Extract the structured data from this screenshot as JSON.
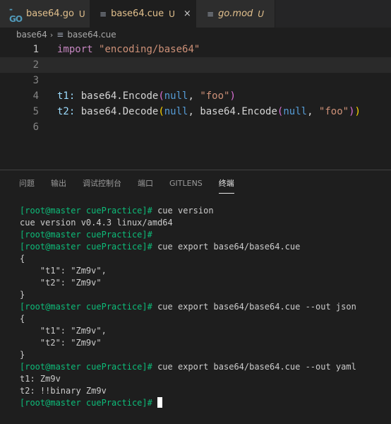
{
  "tabs": [
    {
      "label": "base64.go",
      "modified": "U",
      "icon": "go-file-icon",
      "active": false
    },
    {
      "label": "base64.cue",
      "modified": "U",
      "icon": "lines-file-icon",
      "active": true
    },
    {
      "label": "go.mod",
      "modified": "U",
      "icon": "lines-file-icon",
      "active": false
    }
  ],
  "tab_close": "×",
  "breadcrumb": {
    "folder": "base64",
    "separator": "›",
    "file": "base64.cue"
  },
  "editor": {
    "line_numbers": [
      "1",
      "2",
      "3",
      "4",
      "5",
      "6"
    ],
    "line1": {
      "kw": "import",
      "str": "\"encoding/base64\""
    },
    "line4": {
      "key": "t1:",
      "pre": " base64.Encode",
      "lp": "(",
      "nul": "null",
      ", ": ", ",
      "str": "\"foo\"",
      "rp": ")"
    },
    "line5": {
      "key": "t2:",
      "pre": " base64.Decode",
      "lp": "(",
      "nul": "null",
      "mid": ", base64.Encode",
      "lp2": "(",
      "nul2": "null",
      "comma": ", ",
      "str": "\"foo\"",
      "rp2": ")",
      "rp": ")"
    }
  },
  "panel_tabs": [
    "问题",
    "输出",
    "调试控制台",
    "端口",
    "GITLENS",
    "终端"
  ],
  "terminal": {
    "prompt": "[root@master cuePractice]#",
    "lines": [
      {
        "type": "cmd",
        "text": " cue version"
      },
      {
        "type": "out",
        "text": "cue version v0.4.3 linux/amd64"
      },
      {
        "type": "cmd",
        "text": ""
      },
      {
        "type": "cmd",
        "text": " cue export base64/base64.cue"
      },
      {
        "type": "out",
        "text": "{"
      },
      {
        "type": "out",
        "text": "    \"t1\": \"Zm9v\","
      },
      {
        "type": "out",
        "text": "    \"t2\": \"Zm9v\""
      },
      {
        "type": "out",
        "text": "}"
      },
      {
        "type": "cmd",
        "text": " cue export base64/base64.cue --out json"
      },
      {
        "type": "out",
        "text": "{"
      },
      {
        "type": "out",
        "text": "    \"t1\": \"Zm9v\","
      },
      {
        "type": "out",
        "text": "    \"t2\": \"Zm9v\""
      },
      {
        "type": "out",
        "text": "}"
      },
      {
        "type": "cmd",
        "text": " cue export base64/base64.cue --out yaml"
      },
      {
        "type": "out",
        "text": "t1: Zm9v"
      },
      {
        "type": "out",
        "text": "t2: !!binary Zm9v"
      },
      {
        "type": "cmd",
        "text": " "
      }
    ]
  },
  "colors": {
    "accent_tab_text": "#e2c08d",
    "prompt": "#0dbc79",
    "keyword": "#c586c0",
    "string": "#ce9178",
    "property": "#9cdcfe",
    "null": "#569cd6"
  }
}
